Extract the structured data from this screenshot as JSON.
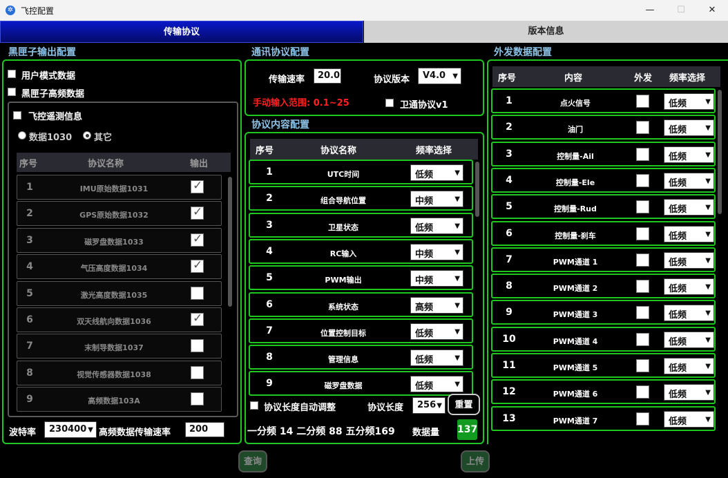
{
  "window": {
    "title": "飞控配置",
    "minimize": "—",
    "maximize": "☐",
    "close": "✕"
  },
  "tabs": [
    "传输协议",
    "版本信息"
  ],
  "left": {
    "section": "黑匣子输出配置",
    "user_mode": "用户模式数据",
    "hf_data": "黑匣子高频数据",
    "telemetry": "飞控遥测信息",
    "radio1": "数据1030",
    "radio2": "其它",
    "headers": [
      "序号",
      "协议名称",
      "输出"
    ],
    "rows": [
      {
        "no": "1",
        "name": "IMU原始数据1031",
        "checked": true
      },
      {
        "no": "2",
        "name": "GPS原始数据1032",
        "checked": true
      },
      {
        "no": "3",
        "name": "磁罗盘数据1033",
        "checked": true
      },
      {
        "no": "4",
        "name": "气压高度数据1034",
        "checked": true
      },
      {
        "no": "5",
        "name": "激光高度数据1035",
        "checked": false
      },
      {
        "no": "6",
        "name": "双天线航向数据1036",
        "checked": true
      },
      {
        "no": "7",
        "name": "末制导数据1037",
        "checked": false
      },
      {
        "no": "8",
        "name": "视觉传感器数据1038",
        "checked": false
      },
      {
        "no": "9",
        "name": "高频数据103A",
        "checked": false
      }
    ],
    "baud_label": "波特率",
    "baud": "230400",
    "hf_rate_label": "高频数据传输速率",
    "hf_rate": "200"
  },
  "comm": {
    "section": "通讯协议配置",
    "rate_label": "传输速率",
    "rate": "20.0",
    "ver_label": "协议版本",
    "ver": "V4.0",
    "range": "手动输入范围: 0.1~25",
    "weitong": "卫通协议v1"
  },
  "content": {
    "section": "协议内容配置",
    "headers": [
      "序号",
      "协议名称",
      "频率选择"
    ],
    "rows": [
      {
        "no": "1",
        "name": "UTC时间",
        "freq": "低频"
      },
      {
        "no": "2",
        "name": "组合导航位置",
        "freq": "中频"
      },
      {
        "no": "3",
        "name": "卫星状态",
        "freq": "低频"
      },
      {
        "no": "4",
        "name": "RC输入",
        "freq": "中频"
      },
      {
        "no": "5",
        "name": "PWM输出",
        "freq": "中频"
      },
      {
        "no": "6",
        "name": "系统状态",
        "freq": "高频"
      },
      {
        "no": "7",
        "name": "位置控制目标",
        "freq": "低频"
      },
      {
        "no": "8",
        "name": "管理信息",
        "freq": "低频"
      },
      {
        "no": "9",
        "name": "磁罗盘数据",
        "freq": "低频"
      }
    ],
    "auto_adjust": "协议长度自动调整",
    "len_label": "协议长度",
    "len": "256",
    "reset": "重置",
    "stats": "一分频 14 二分频 88 五分频169",
    "count_label": "数据量",
    "count": "137"
  },
  "external": {
    "section": "外发数据配置",
    "headers": [
      "序号",
      "内容",
      "外发",
      "频率选择"
    ],
    "rows": [
      {
        "no": "1",
        "name": "点火信号",
        "freq": "低频"
      },
      {
        "no": "2",
        "name": "油门",
        "freq": "低频"
      },
      {
        "no": "3",
        "name": "控制量-Ail",
        "freq": "低频"
      },
      {
        "no": "4",
        "name": "控制量-Ele",
        "freq": "低频"
      },
      {
        "no": "5",
        "name": "控制量-Rud",
        "freq": "低频"
      },
      {
        "no": "6",
        "name": "控制量-刹车",
        "freq": "低频"
      },
      {
        "no": "7",
        "name": "PWM通道 1",
        "freq": "低频"
      },
      {
        "no": "8",
        "name": "PWM通道 2",
        "freq": "低频"
      },
      {
        "no": "9",
        "name": "PWM通道 3",
        "freq": "低频"
      },
      {
        "no": "10",
        "name": "PWM通道 4",
        "freq": "低频"
      },
      {
        "no": "11",
        "name": "PWM通道 5",
        "freq": "低频"
      },
      {
        "no": "12",
        "name": "PWM通道 6",
        "freq": "低频"
      },
      {
        "no": "13",
        "name": "PWM通道 7",
        "freq": "低频"
      }
    ]
  },
  "buttons": {
    "query": "查询",
    "upload": "上传"
  },
  "colors": {
    "panel_border": "#1fc81f",
    "section": "#8cc2e6",
    "warn": "#ff2020",
    "count_bg": "#139a20",
    "tab_active": "#0a18c8"
  }
}
